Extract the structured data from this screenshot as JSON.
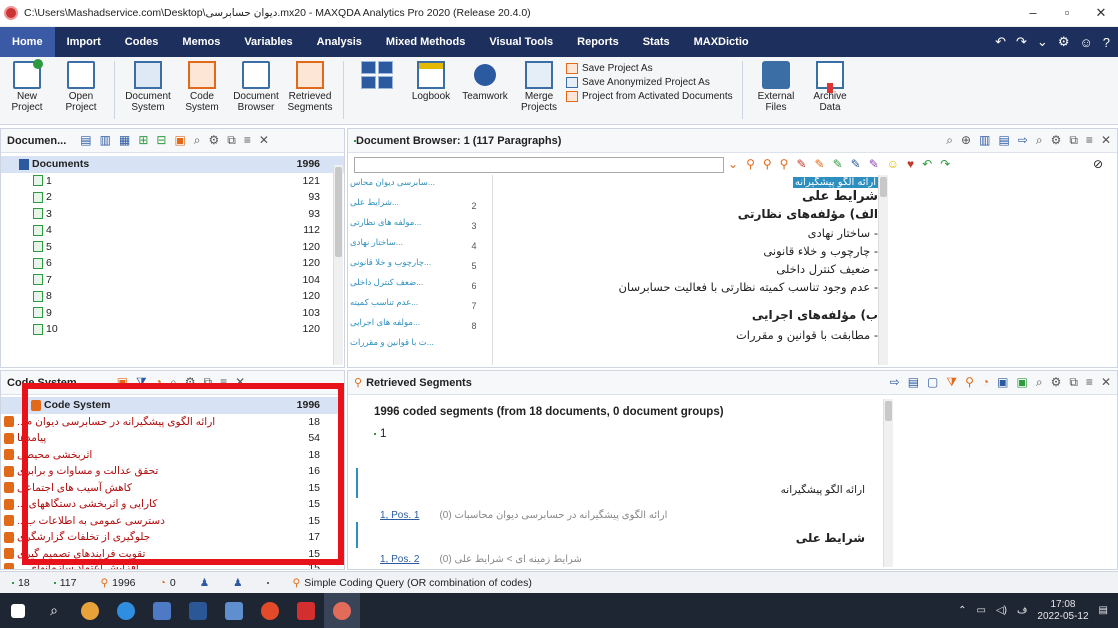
{
  "window": {
    "title": "C:\\Users\\Mashadservice.com\\Desktop\\دیوان حسابرسی.mx20 - MAXQDA Analytics Pro 2020 (Release 20.4.0)",
    "min": "–",
    "max": "▫",
    "close": "✕"
  },
  "ribbon_tabs": [
    "Home",
    "Import",
    "Codes",
    "Memos",
    "Variables",
    "Analysis",
    "Mixed Methods",
    "Visual Tools",
    "Reports",
    "Stats",
    "MAXDictio"
  ],
  "ribbon_right": [
    "↶",
    "↷",
    "⌄",
    "⚙",
    "☺",
    "?"
  ],
  "ribbon": {
    "new_project": "New Project",
    "open_project": "Open Project",
    "document_system": "Document System",
    "code_system": "Code System",
    "document_browser": "Document Browser",
    "retrieved_segments": "Retrieved Segments",
    "logbook": "Logbook",
    "teamwork": "Teamwork",
    "merge_projects": "Merge Projects",
    "save_project_as": "Save Project As",
    "save_anonymized": "Save Anonymized Project As",
    "project_from_activated": "Project from Activated Documents",
    "external_files": "External Files",
    "archive_data": "Archive Data"
  },
  "documents_panel": {
    "title": "Documen...",
    "root_label": "Documents",
    "root_count": "1996",
    "rows": [
      {
        "label": "1",
        "count": "121"
      },
      {
        "label": "2",
        "count": "93"
      },
      {
        "label": "3",
        "count": "93"
      },
      {
        "label": "4",
        "count": "112"
      },
      {
        "label": "5",
        "count": "120"
      },
      {
        "label": "6",
        "count": "120"
      },
      {
        "label": "7",
        "count": "104"
      },
      {
        "label": "8",
        "count": "120"
      },
      {
        "label": "9",
        "count": "103"
      },
      {
        "label": "10",
        "count": "120"
      }
    ]
  },
  "code_system_panel": {
    "title": "Code System",
    "root_label": "Code System",
    "root_count": "1996",
    "rows": [
      {
        "label": "ارائه الگوی پیشگیرانه در حسابرسی دیوان م...",
        "count": "18"
      },
      {
        "label": "پیامدها",
        "count": "54"
      },
      {
        "label": "اثربخشی محیطی",
        "count": "18"
      },
      {
        "label": "تحقق عدالت و مساوات و برابری",
        "count": "16"
      },
      {
        "label": "کاهش آسیب های اجتماعی",
        "count": "15"
      },
      {
        "label": "کارایی و اثربخشی دستگاههای ...",
        "count": "15"
      },
      {
        "label": "دسترسی عمومی به اطلاعات ب...",
        "count": "15"
      },
      {
        "label": "جلوگیری از تخلفات گزارشگری",
        "count": "17"
      },
      {
        "label": "تقویت فرایندهای تصمیم گیری",
        "count": "15"
      },
      {
        "label": "افزایش اعتماد سازمانهای ...",
        "count": "15"
      }
    ]
  },
  "browser_panel": {
    "title": "Document Browser: 1  (117 Paragraphs)",
    "code_stripes": [
      "سابرسی دیوان محاس...",
      "شرایط علی...",
      "مولفه های نظارتی...",
      "ساختار نهادی...",
      "چارچوب و خلا قانونی...",
      "ضعف کنترل داخلی...",
      "عدم تناسب کمیته...",
      "مولفه های اجرایی...",
      "ت با قوانین و مقررات..."
    ],
    "line_numbers": [
      "2",
      "3",
      "4",
      "5",
      "6",
      "7",
      "8"
    ],
    "lines": [
      "ارائه الگو پیشگیرانه",
      "شرایط علی",
      "الف) مؤلفه‌های نظارتی",
      "- ساختار نهادی",
      "- چارچوب و خلاء قانونی",
      "- ضعیف کنترل داخلی",
      "- عدم وجود تناسب کمیته نظارتی با فعالیت حسابرسان",
      "ب) مؤلفه‌های اجرایی",
      "- مطابقت با قوانین و مقررات"
    ]
  },
  "retrieved_panel": {
    "title": "Retrieved Segments",
    "summary": "1996 coded segments (from 18 documents, 0 document groups)",
    "doc_label": "1",
    "seg1_text": "ارائه الگو پیشگیرانه",
    "seg1_pos": "1, Pos. 1",
    "seg1_code": "(0) ارائه الگوی پیشگیرانه در حسابرسی دیوان محاسبات",
    "seg2_text": "شرایط علی",
    "seg2_pos": "1, Pos. 2",
    "seg2_code": "(0) شرایط زمینه ای > شرایط علی"
  },
  "status_bar": {
    "docs": "18",
    "paragraphs": "117",
    "segments": "1996",
    "activated": "0",
    "query": "Simple Coding Query (OR combination of codes)"
  },
  "taskbar": {
    "time": "17:08",
    "date": "2022-05-12",
    "lang": "ف"
  },
  "colors": {
    "ribbon": "#1d2f5c",
    "highlight": "#e8131a",
    "code": "#e06a1a",
    "doc": "#2c5aa0"
  }
}
